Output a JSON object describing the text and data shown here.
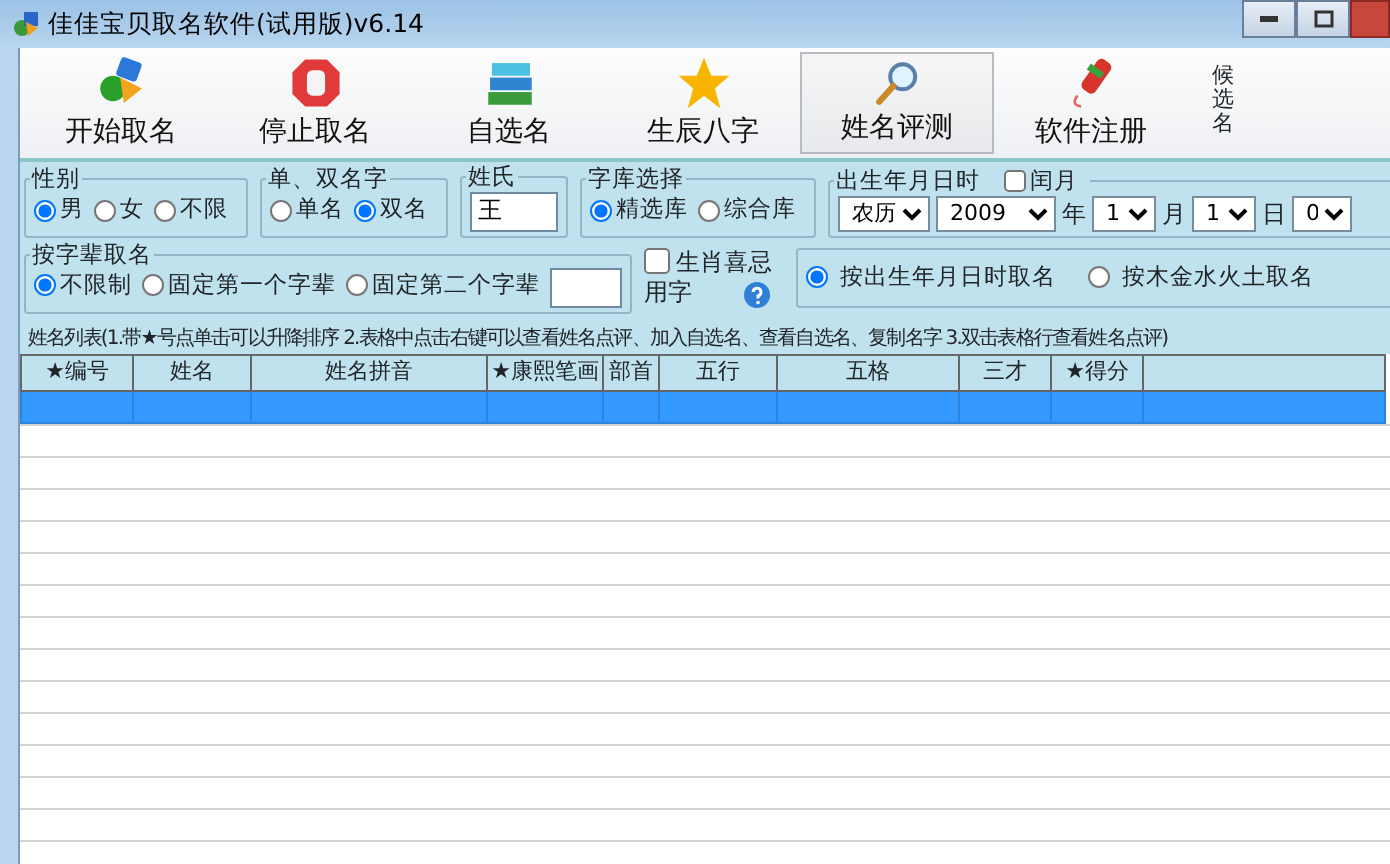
{
  "window": {
    "title": "佳佳宝贝取名软件(试用版)v6.14"
  },
  "toolbar": [
    {
      "label": "开始取名",
      "kind": "shapes",
      "selected": false
    },
    {
      "label": "停止取名",
      "kind": "stop",
      "selected": false
    },
    {
      "label": "自选名",
      "kind": "books",
      "selected": false
    },
    {
      "label": "生辰八字",
      "kind": "star",
      "selected": false
    },
    {
      "label": "姓名评测",
      "kind": "magnifier",
      "selected": true
    },
    {
      "label": "软件注册",
      "kind": "pen",
      "selected": false
    }
  ],
  "candidate_label": "候选名",
  "gender": {
    "legend": "性别",
    "options": [
      {
        "label": "男",
        "selected": true
      },
      {
        "label": "女",
        "selected": false
      },
      {
        "label": "不限",
        "selected": false
      }
    ]
  },
  "name_length": {
    "legend": "单、双名字",
    "options": [
      {
        "label": "单名",
        "selected": false
      },
      {
        "label": "双名",
        "selected": true
      }
    ]
  },
  "surname": {
    "legend": "姓氏",
    "value": "王"
  },
  "library": {
    "legend": "字库选择",
    "options": [
      {
        "label": "精选库",
        "selected": true
      },
      {
        "label": "综合库",
        "selected": false
      }
    ]
  },
  "birth": {
    "legend": "出生年月日时",
    "leap_month": {
      "label": "闰月",
      "checked": false
    },
    "calendar": "农历",
    "year": "2009",
    "year_unit": "年",
    "month": "1",
    "month_unit": "月",
    "day": "1",
    "day_unit": "日",
    "hour": "0"
  },
  "generation": {
    "legend": "按字辈取名",
    "options": [
      {
        "label": "不限制",
        "selected": true
      },
      {
        "label": "固定第一个字辈",
        "selected": false
      },
      {
        "label": "固定第二个字辈",
        "selected": false
      }
    ]
  },
  "zodiac": {
    "label": "生肖喜忌用字",
    "checked": false
  },
  "mode": {
    "options": [
      {
        "label": "按出生年月日时取名",
        "selected": true
      },
      {
        "label": "按木金水火土取名",
        "selected": false
      }
    ]
  },
  "table": {
    "caption": "姓名列表(1.带★号点单击可以升降排序 2.表格中点击右键可以查看姓名点评、加入自选名、查看自选名、复制名字 3.双击表格行查看姓名点评)",
    "columns": [
      "★编号",
      "姓名",
      "姓名拼音",
      "★康熙笔画",
      "部首",
      "五行",
      "五格",
      "三才",
      "★得分"
    ],
    "rows": [
      {
        "selected": true
      }
    ]
  }
}
